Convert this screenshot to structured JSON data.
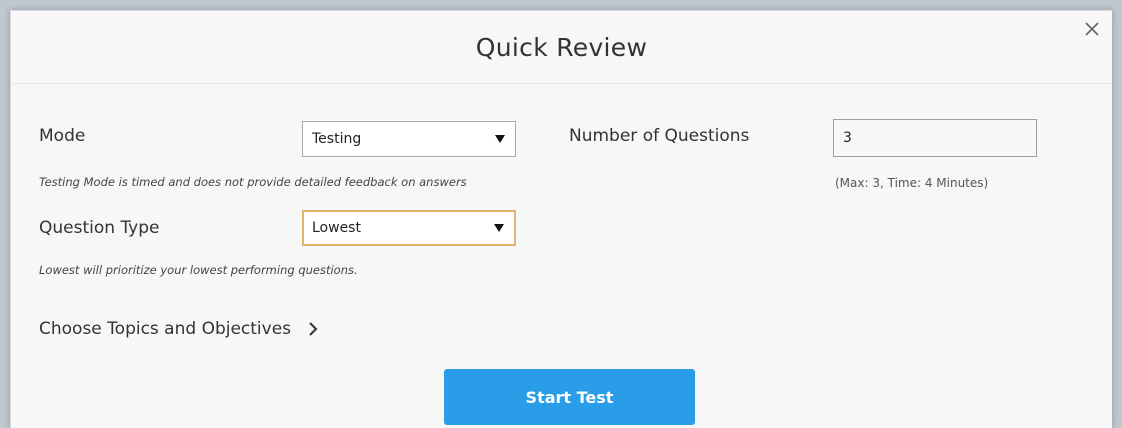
{
  "modal": {
    "title": "Quick Review",
    "close_icon": "close-icon"
  },
  "mode": {
    "label": "Mode",
    "selected": "Testing",
    "hint": "Testing Mode is timed and does not provide detailed feedback on answers"
  },
  "questions": {
    "label": "Number of Questions",
    "value": "3",
    "note": "(Max: 3, Time: 4 Minutes)"
  },
  "question_type": {
    "label": "Question Type",
    "selected": "Lowest",
    "hint": "Lowest will prioritize your lowest performing questions."
  },
  "topics": {
    "label": "Choose Topics and Objectives",
    "icon": "chevron-right-icon"
  },
  "actions": {
    "start_label": "Start Test"
  },
  "colors": {
    "accent": "#2a9de8",
    "focus_border": "#e3b26d"
  }
}
